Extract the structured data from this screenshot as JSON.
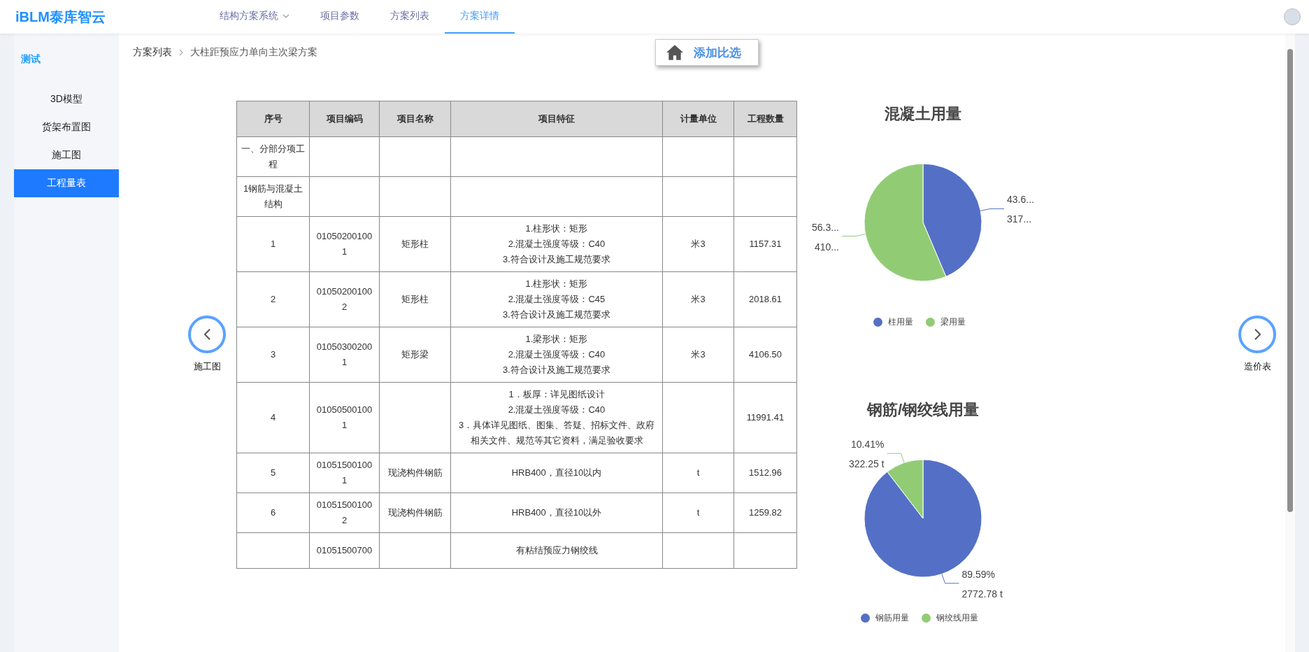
{
  "app": {
    "logo": "iBLM泰库智云"
  },
  "nav": [
    {
      "label": "结构方案系统",
      "dropdown": true,
      "selected": false
    },
    {
      "label": "项目参数",
      "dropdown": false,
      "selected": false
    },
    {
      "label": "方案列表",
      "dropdown": false,
      "selected": false
    },
    {
      "label": "方案详情",
      "dropdown": false,
      "selected": true
    }
  ],
  "sidebar": {
    "title": "测试",
    "items": [
      {
        "label": "3D模型",
        "selected": false
      },
      {
        "label": "货架布置图",
        "selected": false
      },
      {
        "label": "施工图",
        "selected": false
      },
      {
        "label": "工程量表",
        "selected": true
      }
    ]
  },
  "breadcrumb": [
    "方案列表",
    "大柱距预应力单向主次梁方案"
  ],
  "compare_button": "添加比选",
  "prev": {
    "label": "施工图"
  },
  "next": {
    "label": "造价表"
  },
  "table": {
    "columns": [
      "序号",
      "项目编码",
      "项目名称",
      "项目特征",
      "计量单位",
      "工程数量"
    ],
    "rows": [
      [
        "一、分部分项工程",
        "",
        "",
        "",
        "",
        ""
      ],
      [
        "1钢筋与混凝土结构",
        "",
        "",
        "",
        "",
        ""
      ],
      [
        "1",
        "010502001001",
        "矩形柱",
        "1.柱形状：矩形\n2.混凝土强度等级：C40\n3.符合设计及施工规范要求",
        "米3",
        "1157.31"
      ],
      [
        "2",
        "010502001002",
        "矩形柱",
        "1.柱形状：矩形\n2.混凝土强度等级：C45\n3.符合设计及施工规范要求",
        "米3",
        "2018.61"
      ],
      [
        "3",
        "010503002001",
        "矩形梁",
        "1.梁形状：矩形\n2.混凝土强度等级：C40\n3.符合设计及施工规范要求",
        "米3",
        "4106.50"
      ],
      [
        "4",
        "010505001001",
        "",
        "1．板厚：详见图纸设计\n2.混凝土强度等级：C40\n3．具体详见图纸、图集、答疑、招标文件、政府相关文件、规范等其它资料，满足验收要求",
        "",
        "11991.41"
      ],
      [
        "5",
        "010515001001",
        "现浇构件钢筋",
        "HRB400，直径10以内",
        "t",
        "1512.96"
      ],
      [
        "6",
        "010515001002",
        "现浇构件钢筋",
        "HRB400，直径10以外",
        "t",
        "1259.82"
      ],
      [
        "",
        "01051500700",
        "",
        "有粘结预应力钢绞线",
        "",
        ""
      ]
    ]
  },
  "charts": [
    {
      "chart_data": {
        "type": "pie",
        "title": "混凝土用量",
        "categories": [
          "柱用量",
          "梁用量"
        ],
        "values": [
          43.61,
          56.39
        ],
        "legend": "bottom"
      },
      "slices": [
        {
          "color": "#5470c6",
          "percent": "43.6...",
          "amount": "317..."
        },
        {
          "color": "#91cc75",
          "percent": "56.3...",
          "amount": "410..."
        }
      ]
    },
    {
      "chart_data": {
        "type": "pie",
        "title": "钢筋/钢绞线用量",
        "categories": [
          "钢筋用量",
          "钢绞线用量"
        ],
        "values": [
          89.59,
          10.41
        ],
        "legend": "bottom"
      },
      "slices": [
        {
          "color": "#5470c6",
          "percent": "89.59%",
          "amount": "2772.78 t"
        },
        {
          "color": "#91cc75",
          "percent": "10.41%",
          "amount": "322.25 t"
        }
      ]
    }
  ]
}
